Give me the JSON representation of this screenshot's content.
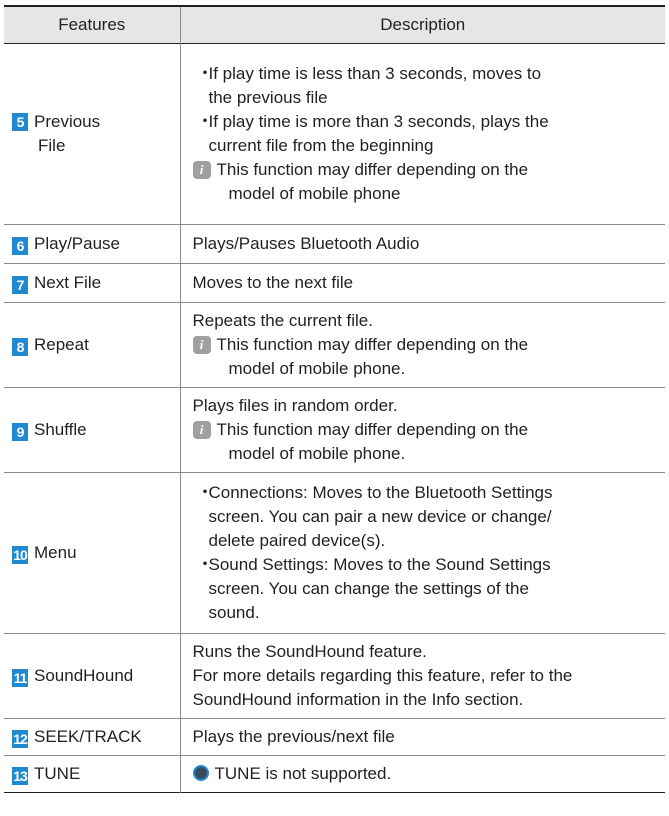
{
  "header": {
    "features": "Features",
    "description": "Description"
  },
  "rows": [
    {
      "num": "5",
      "feature_line1": "Previous",
      "feature_line2": "File",
      "bullets": [
        [
          "If play time is less than 3 seconds, moves to",
          "the previous file"
        ],
        [
          "If play time is more than 3 seconds, plays the",
          "current file from the beginning"
        ]
      ],
      "note": [
        "This function may differ depending on the",
        "model of mobile phone"
      ]
    },
    {
      "num": "6",
      "feature": "Play/Pause",
      "text": "Plays/Pauses Bluetooth Audio"
    },
    {
      "num": "7",
      "feature": "Next File",
      "text": "Moves to the next file"
    },
    {
      "num": "8",
      "feature": "Repeat",
      "text": "Repeats the current file.",
      "note": [
        "This function may differ depending on the",
        "model of mobile phone."
      ]
    },
    {
      "num": "9",
      "feature": "Shuffle",
      "text": "Plays files in random order.",
      "note": [
        "This function may differ depending on the",
        "model of mobile phone."
      ]
    },
    {
      "num": "10",
      "feature": "Menu",
      "bullets": [
        [
          "Connections: Moves to the Bluetooth Settings",
          "screen. You can pair a new device or change/",
          "delete paired device(s)."
        ],
        [
          "Sound Settings: Moves to the Sound Settings",
          "screen. You can change the settings of the",
          "sound."
        ]
      ]
    },
    {
      "num": "11",
      "feature": "SoundHound",
      "lines": [
        "Runs the SoundHound feature.",
        "For more details regarding this feature, refer to the",
        "SoundHound information in the Info section."
      ]
    },
    {
      "num": "12",
      "feature": "SEEK/TRACK",
      "text": "Plays the previous/next file"
    },
    {
      "num": "13",
      "feature": "TUNE",
      "text": "TUNE is not supported."
    }
  ],
  "icons": {
    "number_badge_color": "#1f8ad0",
    "info_icon": "info-icon",
    "info_icon_color": "#a0a0a0",
    "bullet_glyph": "・"
  }
}
